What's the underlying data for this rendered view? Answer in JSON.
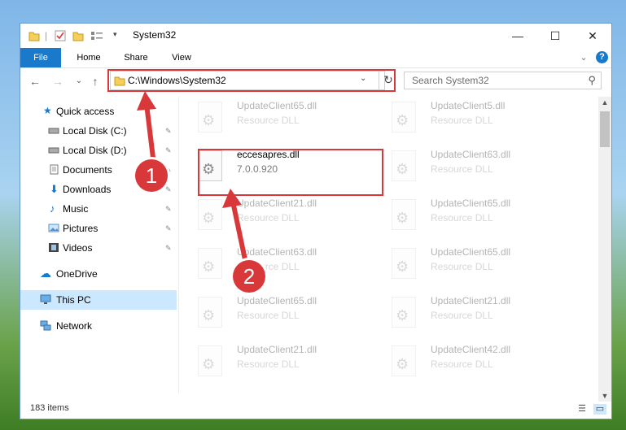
{
  "window": {
    "title": "System32",
    "controls": {
      "minimize": "—",
      "maximize": "☐",
      "close": "✕"
    }
  },
  "ribbon": {
    "tabs": [
      "File",
      "Home",
      "Share",
      "View"
    ],
    "expand_glyph": "⌄",
    "help_glyph": "?"
  },
  "nav": {
    "back_glyph": "←",
    "forward_glyph": "→",
    "recent_glyph": "⌄",
    "up_glyph": "↑",
    "address": "C:\\Windows\\System32",
    "address_dropdown_glyph": "⌄",
    "refresh_glyph": "↻",
    "search_placeholder": "Search System32",
    "search_glyph": "⚲"
  },
  "sidebar": {
    "items": [
      {
        "label": "Quick access",
        "icon": "star-icon",
        "pinned": false
      },
      {
        "label": "Local Disk (C:)",
        "icon": "drive-icon",
        "pinned": true
      },
      {
        "label": "Local Disk (D:)",
        "icon": "drive-icon",
        "pinned": true
      },
      {
        "label": "Documents",
        "icon": "documents-icon",
        "pinned": true
      },
      {
        "label": "Downloads",
        "icon": "downloads-icon",
        "pinned": true
      },
      {
        "label": "Music",
        "icon": "music-icon",
        "pinned": true
      },
      {
        "label": "Pictures",
        "icon": "pictures-icon",
        "pinned": true
      },
      {
        "label": "Videos",
        "icon": "videos-icon",
        "pinned": true
      },
      {
        "label": "OneDrive",
        "icon": "cloud-icon",
        "pinned": false
      },
      {
        "label": "This PC",
        "icon": "computer-icon",
        "pinned": false,
        "selected": true
      },
      {
        "label": "Network",
        "icon": "network-icon",
        "pinned": false
      }
    ],
    "pin_glyph": "📌"
  },
  "files": [
    {
      "name": "UpdateClient65.dll",
      "desc": "Resource DLL",
      "faded": true
    },
    {
      "name": "UpdateClient5.dll",
      "desc": "Resource DLL",
      "faded": true
    },
    {
      "name": "eccesapres.dll",
      "desc": "7.0.0.920",
      "faded": false
    },
    {
      "name": "UpdateClient63.dll",
      "desc": "Resource DLL",
      "faded": true
    },
    {
      "name": "UpdateClient21.dll",
      "desc": "Resource DLL",
      "faded": true
    },
    {
      "name": "UpdateClient65.dll",
      "desc": "Resource DLL",
      "faded": true
    },
    {
      "name": "UpdateClient63.dll",
      "desc": "Resource DLL",
      "faded": true
    },
    {
      "name": "UpdateClient65.dll",
      "desc": "Resource DLL",
      "faded": true
    },
    {
      "name": "UpdateClient65.dll",
      "desc": "Resource DLL",
      "faded": true
    },
    {
      "name": "UpdateClient21.dll",
      "desc": "Resource DLL",
      "faded": true
    },
    {
      "name": "UpdateClient21.dll",
      "desc": "Resource DLL",
      "faded": true
    },
    {
      "name": "UpdateClient42.dll",
      "desc": "Resource DLL",
      "faded": true
    }
  ],
  "status": {
    "items_count": "183 items"
  },
  "callouts": {
    "one": "1",
    "two": "2"
  },
  "colors": {
    "accent": "#1979ca",
    "highlight": "#d9383a",
    "selected": "#cce8ff"
  }
}
